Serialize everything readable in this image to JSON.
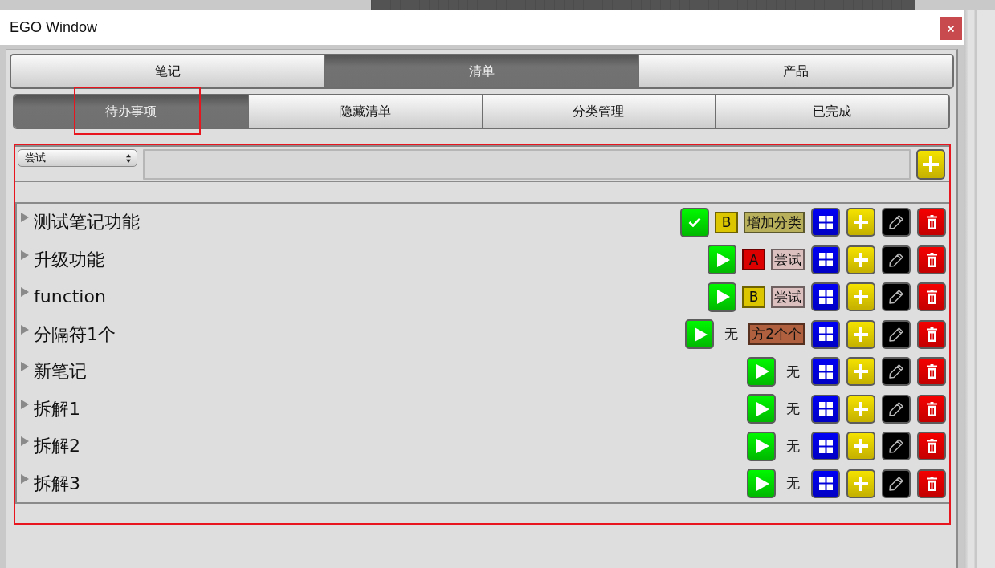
{
  "window": {
    "title": "EGO Window"
  },
  "tabs": [
    {
      "label": "笔记",
      "selected": false
    },
    {
      "label": "清单",
      "selected": true
    },
    {
      "label": "产品",
      "selected": false
    }
  ],
  "sub_tabs": [
    {
      "label": "待办事项",
      "selected": true,
      "highlighted": true
    },
    {
      "label": "隐藏清单",
      "selected": false,
      "highlighted": false
    },
    {
      "label": "分类管理",
      "selected": false,
      "highlighted": false
    },
    {
      "label": "已完成",
      "selected": false,
      "highlighted": false
    }
  ],
  "list_panel": {
    "highlighted": true,
    "category_select": {
      "value": "尝试"
    },
    "items": [
      {
        "title": "测试笔记功能",
        "expanded": false,
        "done": true,
        "priority": {
          "kind": "tag",
          "label": "B",
          "color": "#dcc600"
        },
        "category": {
          "label": "增加分类",
          "color": "#b8b05a"
        }
      },
      {
        "title": "升级功能",
        "expanded": false,
        "done": false,
        "priority": {
          "kind": "tag",
          "label": "A",
          "color": "#dc0000"
        },
        "category": {
          "label": "尝试",
          "color": "#dcc0c0"
        }
      },
      {
        "title": "function",
        "expanded": false,
        "done": false,
        "priority": {
          "kind": "tag",
          "label": "B",
          "color": "#dcc600"
        },
        "category": {
          "label": "尝试",
          "color": "#dcc0c0"
        }
      },
      {
        "title": "分隔符1个",
        "expanded": false,
        "done": false,
        "priority": {
          "kind": "plain",
          "label": "无"
        },
        "category": {
          "label": "方2个个",
          "color": "#b0603e"
        }
      },
      {
        "title": "新笔记",
        "expanded": false,
        "done": false,
        "priority": {
          "kind": "plain",
          "label": "无"
        }
      },
      {
        "title": "拆解1",
        "expanded": false,
        "done": false,
        "priority": {
          "kind": "plain",
          "label": "无"
        }
      },
      {
        "title": "拆解2",
        "expanded": false,
        "done": false,
        "priority": {
          "kind": "plain",
          "label": "无"
        }
      },
      {
        "title": "拆解3",
        "expanded": false,
        "done": false,
        "priority": {
          "kind": "plain",
          "label": "无"
        }
      }
    ]
  }
}
